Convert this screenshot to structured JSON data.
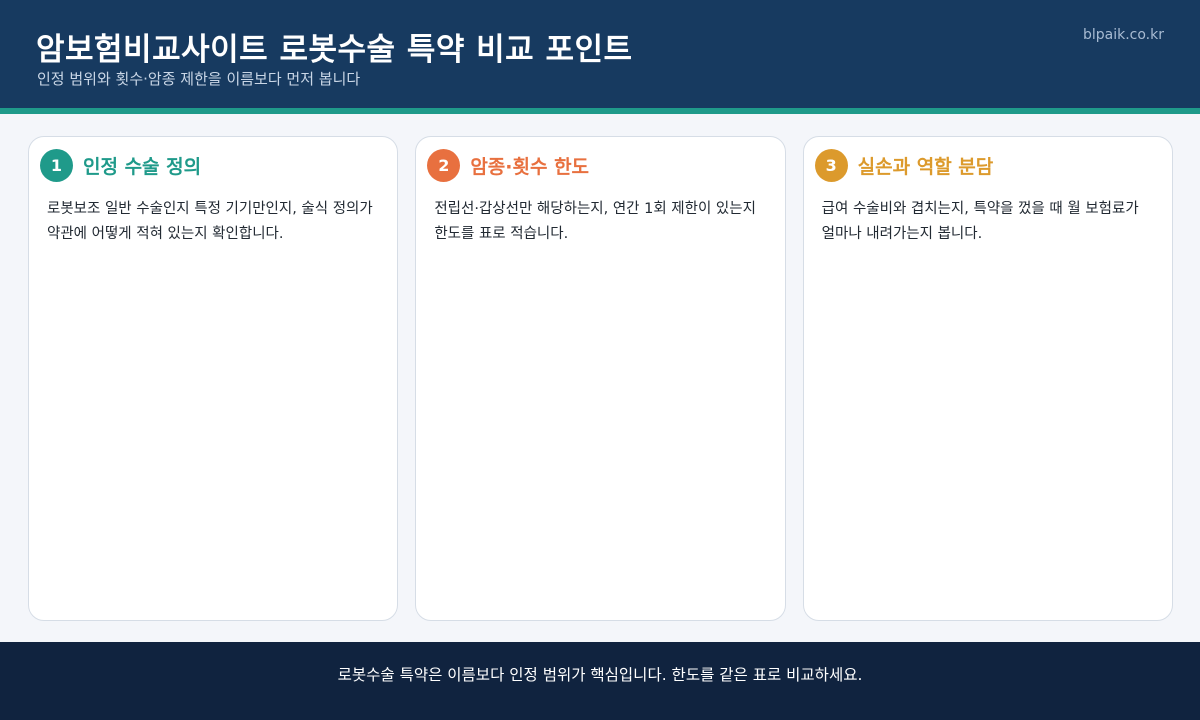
{
  "header": {
    "title": "암보험비교사이트 로봇수술 특약 비교 포인트",
    "subtitle": "인정 범위와 횟수·암종 제한을 이름보다 먼저 봅니다",
    "site": "blpaik.co.kr"
  },
  "cards": [
    {
      "number": "1",
      "title": "인정 수술 정의",
      "body": "로봇보조 일반 수술인지 특정 기기만인지, 술식 정의가 약관에 어떻게 적혀 있는지 확인합니다.",
      "color": "#1f9a8a"
    },
    {
      "number": "2",
      "title": "암종·횟수 한도",
      "body": "전립선·갑상선만 해당하는지, 연간 1회 제한이 있는지 한도를 표로 적습니다.",
      "color": "#e8703f"
    },
    {
      "number": "3",
      "title": "실손과 역할 분담",
      "body": "급여 수술비와 겹치는지, 특약을 껐을 때 월 보험료가 얼마나 내려가는지 봅니다.",
      "color": "#dc9a2c"
    }
  ],
  "footer": {
    "text": "로봇수술 특약은 이름보다 인정 범위가 핵심입니다. 한도를 같은 표로 비교하세요."
  }
}
